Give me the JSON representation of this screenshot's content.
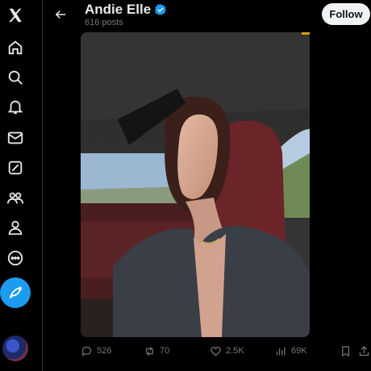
{
  "nav": {
    "items": [
      {
        "icon": "x-logo-icon"
      },
      {
        "icon": "home-icon"
      },
      {
        "icon": "search-icon"
      },
      {
        "icon": "notifications-icon"
      },
      {
        "icon": "messages-icon"
      },
      {
        "icon": "grok-icon"
      },
      {
        "icon": "communities-icon"
      },
      {
        "icon": "profile-icon"
      },
      {
        "icon": "more-icon"
      }
    ],
    "post_button_icon": "compose-icon"
  },
  "header": {
    "name": "Andie Elle",
    "posts_count": "616 posts",
    "follow_label": "Follow"
  },
  "colors": {
    "accent": "#1d9bf0",
    "background": "#000000",
    "muted": "#71767b"
  },
  "actions": {
    "replies": "526",
    "reposts": "70",
    "likes": "2.5K",
    "views": "69K"
  }
}
